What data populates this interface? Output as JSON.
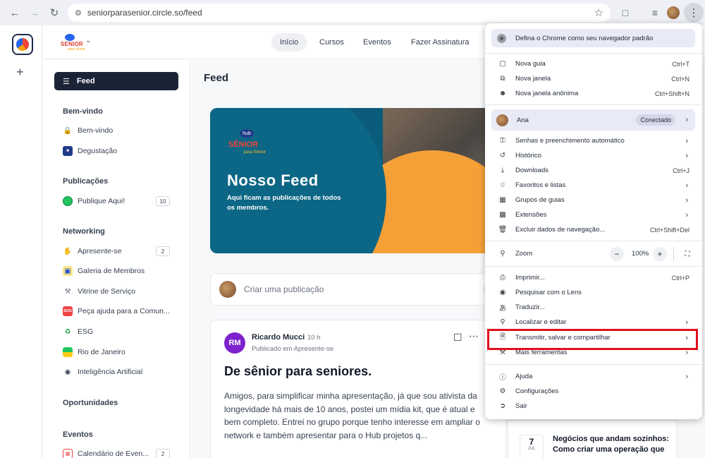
{
  "browser": {
    "url": "seniorparasenior.circle.so/feed"
  },
  "header": {
    "brand_text": "SENIOR",
    "brand_sub": "para sênior",
    "tabs": [
      "Início",
      "Cursos",
      "Eventos",
      "Fazer Assinatura"
    ]
  },
  "sidebar": {
    "feed_label": "Feed",
    "sections": [
      {
        "title": "Bem-vindo"
      },
      {
        "title": "Publicações"
      },
      {
        "title": "Networking"
      },
      {
        "title": "Oportunidades"
      },
      {
        "title": "Eventos"
      }
    ],
    "items": [
      {
        "label": "Bem-vindo",
        "icon": "lock-icon"
      },
      {
        "label": "Degustação",
        "icon": "image-icon"
      },
      {
        "label": "Publique Aqui!",
        "icon": "green-circle-icon",
        "count": "10"
      },
      {
        "label": "Apresente-se",
        "icon": "waving-hand-icon",
        "count": "2"
      },
      {
        "label": "Galeria de Membros",
        "icon": "gallery-icon"
      },
      {
        "label": "Vitrine de Serviço",
        "icon": "tools-icon"
      },
      {
        "label": "Peça ajuda para a Comun...",
        "icon": "sos-icon"
      },
      {
        "label": "ESG",
        "icon": "recycle-icon"
      },
      {
        "label": "Rio de Janeiro",
        "icon": "flag-icon"
      },
      {
        "label": "Inteligência Artificial",
        "icon": "robot-icon"
      },
      {
        "label": "Calendário de Even...",
        "icon": "calendar-icon",
        "count": "2"
      }
    ]
  },
  "main": {
    "title": "Feed",
    "banner": {
      "logo_hub": "hub",
      "logo_senior": "SÊNIOR",
      "logo_para": "para Sênior",
      "title": "Nosso Feed",
      "subtitle": "Aqui ficam as publicações de todos os membros."
    },
    "composer_placeholder": "Criar uma publicação",
    "post": {
      "initials": "RM",
      "author": "Ricardo Mucci",
      "time": "10 h",
      "published_in": "Publicado em Apresente-se",
      "title": "De sênior para seniores.",
      "body": "Amigos, para simplificar minha apresentação, já que sou ativista da longevidade há mais de 10 anos, postei um mídia kit, que é atual e bem completo. Entrei no grupo porque tenho interesse em ampliar o network e também apresentar para o Hub projetos q..."
    },
    "event": {
      "day": "7",
      "month": "JUL",
      "title": "Negócios que andam sozinhos: Como criar uma operação que"
    }
  },
  "chrome_menu": {
    "default_browser": "Defina o Chrome como seu navegador padrão",
    "group1": [
      {
        "label": "Nova guia",
        "shortcut": "Ctrl+T",
        "icon": "new-tab-icon"
      },
      {
        "label": "Nova janela",
        "shortcut": "Ctrl+N",
        "icon": "new-window-icon"
      },
      {
        "label": "Nova janela anônima",
        "shortcut": "Ctrl+Shift+N",
        "icon": "incognito-icon"
      }
    ],
    "profile": {
      "name": "Ana",
      "status": "Conectado"
    },
    "group2": [
      {
        "label": "Senhas e preenchimento automático",
        "icon": "key-icon",
        "arrow": true
      },
      {
        "label": "Histórico",
        "icon": "history-icon",
        "arrow": true
      },
      {
        "label": "Downloads",
        "shortcut": "Ctrl+J",
        "icon": "download-icon"
      },
      {
        "label": "Favoritos e listas",
        "icon": "star-icon",
        "arrow": true
      },
      {
        "label": "Grupos de guias",
        "icon": "tab-groups-icon",
        "arrow": true
      },
      {
        "label": "Extensões",
        "icon": "extension-icon",
        "arrow": true
      },
      {
        "label": "Excluir dados de navegação...",
        "shortcut": "Ctrl+Shift+Del",
        "icon": "trash-icon"
      }
    ],
    "zoom": {
      "label": "Zoom",
      "value": "100%"
    },
    "group3": [
      {
        "label": "Imprimir...",
        "shortcut": "Ctrl+P",
        "icon": "print-icon"
      },
      {
        "label": "Pesquisar com o Lens",
        "icon": "lens-icon"
      },
      {
        "label": "Traduzir...",
        "icon": "translate-icon"
      },
      {
        "label": "Localizar e editar",
        "icon": "find-icon",
        "arrow": true
      },
      {
        "label": "Transmitir, salvar e compartilhar",
        "icon": "cast-save-share-icon",
        "arrow": true
      },
      {
        "label": "Mais ferramentas",
        "icon": "tools-icon",
        "arrow": true
      }
    ],
    "group4": [
      {
        "label": "Ajuda",
        "icon": "help-icon",
        "arrow": true
      },
      {
        "label": "Configurações",
        "icon": "settings-icon"
      },
      {
        "label": "Sair",
        "icon": "exit-icon"
      }
    ]
  },
  "colors": {
    "highlight": "#e0101e",
    "feed_button": "#1b2436",
    "post_avatar": "#7e22ce",
    "banner_blue": "#0c6685",
    "banner_orange": "#f5a037"
  }
}
